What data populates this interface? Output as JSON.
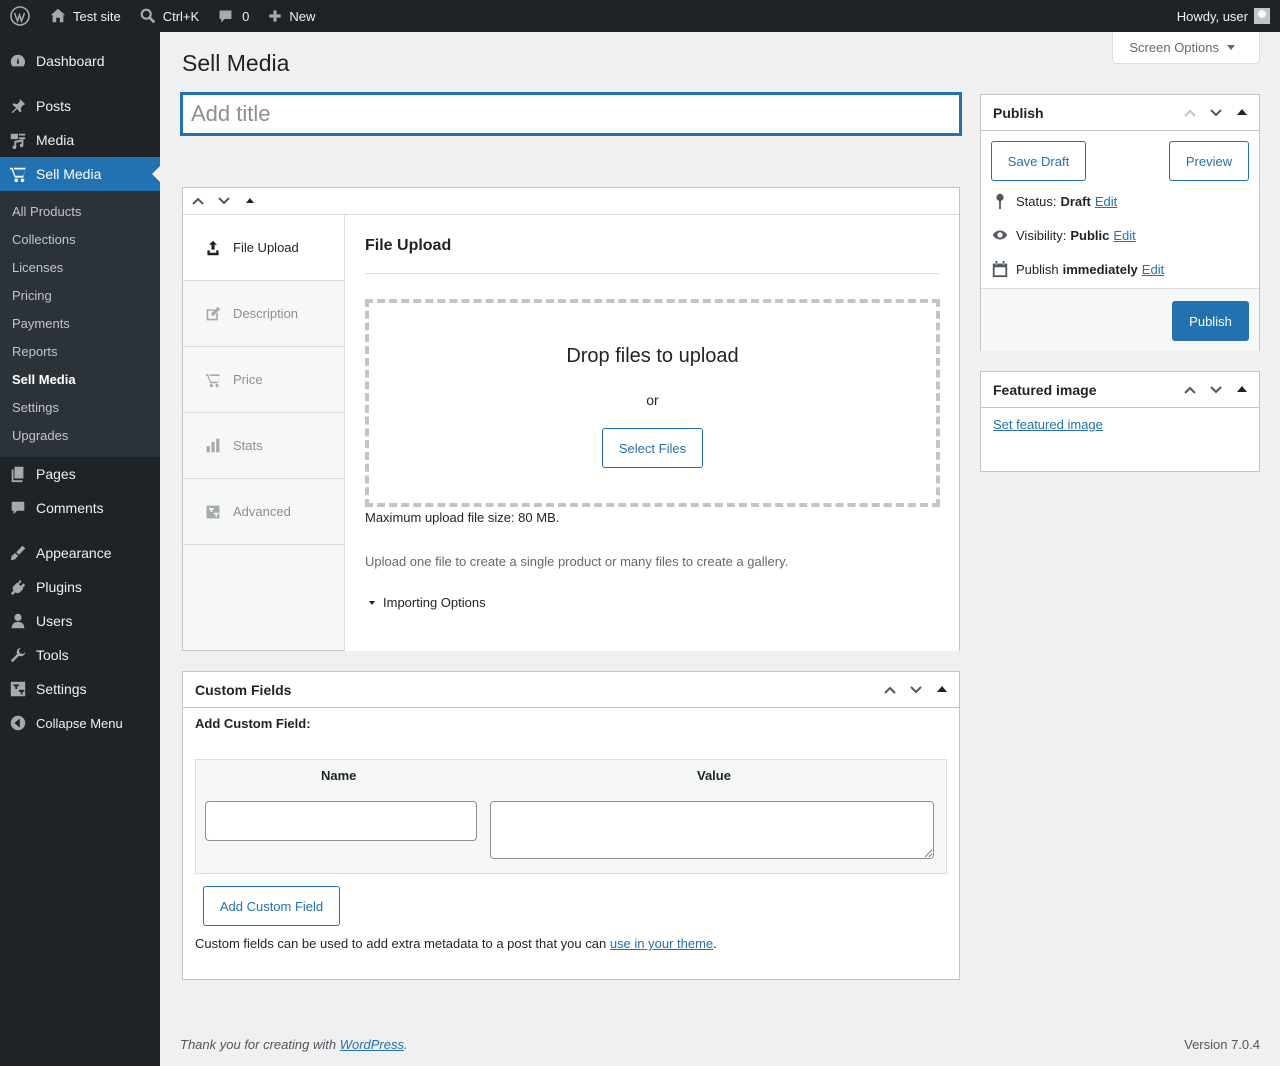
{
  "admin_bar": {
    "site_name": "Test site",
    "search_shortcut": "Ctrl+K",
    "comments_count": "0",
    "new_label": "New",
    "howdy": "Howdy, user"
  },
  "sidebar": {
    "items": [
      {
        "label": "Dashboard",
        "icon": "dashboard-icon"
      },
      {
        "label": "Posts",
        "icon": "pin-icon"
      },
      {
        "label": "Media",
        "icon": "media-icon"
      },
      {
        "label": "Sell Media",
        "icon": "cart-icon"
      },
      {
        "label": "Pages",
        "icon": "pages-icon"
      },
      {
        "label": "Comments",
        "icon": "comment-icon"
      },
      {
        "label": "Appearance",
        "icon": "brush-icon"
      },
      {
        "label": "Plugins",
        "icon": "plugin-icon"
      },
      {
        "label": "Users",
        "icon": "users-icon"
      },
      {
        "label": "Tools",
        "icon": "wrench-icon"
      },
      {
        "label": "Settings",
        "icon": "settings-icon"
      },
      {
        "label": "Collapse Menu",
        "icon": "collapse-icon"
      }
    ],
    "submenu": [
      "All Products",
      "Collections",
      "Licenses",
      "Pricing",
      "Payments",
      "Reports",
      "Sell Media",
      "Settings",
      "Upgrades"
    ]
  },
  "screen_options": "Screen Options",
  "page_title": "Sell Media",
  "title_placeholder": "Add title",
  "sell_media_box": {
    "tabs": [
      "File Upload",
      "Description",
      "Price",
      "Stats",
      "Advanced"
    ],
    "panel_title": "File Upload",
    "drop_title": "Drop files to upload",
    "or": "or",
    "select_files": "Select Files",
    "max_size": "Maximum upload file size: 80 MB.",
    "help": "Upload one file to create a single product or many files to create a gallery.",
    "importing": "Importing Options"
  },
  "custom_fields": {
    "title": "Custom Fields",
    "add_label": "Add Custom Field:",
    "name_header": "Name",
    "value_header": "Value",
    "add_button": "Add Custom Field",
    "note_pre": "Custom fields can be used to add extra metadata to a post that you can ",
    "note_link": "use in your theme",
    "note_post": "."
  },
  "publish": {
    "title": "Publish",
    "save_draft": "Save Draft",
    "preview": "Preview",
    "status_label": "Status:",
    "status_value": "Draft",
    "visibility_label": "Visibility:",
    "visibility_value": "Public",
    "publish_label": "Publish",
    "publish_value": "immediately",
    "edit": "Edit",
    "publish_button": "Publish"
  },
  "featured_image": {
    "title": "Featured image",
    "link": "Set featured image"
  },
  "footer": {
    "thanks_pre": "Thank you for creating with ",
    "thanks_link": "WordPress",
    "thanks_post": ".",
    "version": "Version 7.0.4"
  },
  "colors": {
    "accent": "#2271b1",
    "sidebar_bg": "#1d2327",
    "page_bg": "#f0f0f1"
  }
}
